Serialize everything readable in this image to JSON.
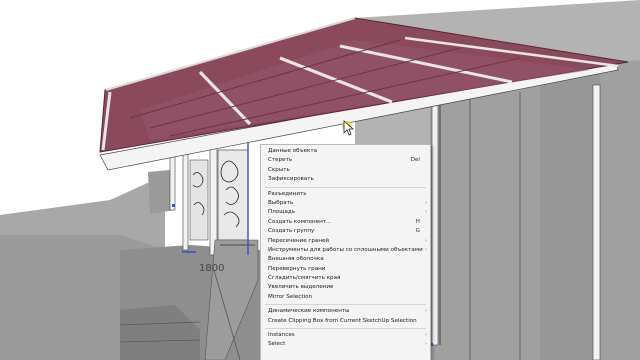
{
  "viewport": {
    "dimension_label": "1800",
    "colors": {
      "roof": "#8a4a5c",
      "roof_edge": "#6a2f3f",
      "wall": "#a3a3a3",
      "ground": "#9c9c9c",
      "background": "#ffffff"
    }
  },
  "context_menu": {
    "items": [
      {
        "label": "Данные объекта",
        "shortcut": "",
        "submenu": false
      },
      {
        "label": "Стереть",
        "shortcut": "Del",
        "submenu": false
      },
      {
        "label": "Скрыть",
        "shortcut": "",
        "submenu": false
      },
      {
        "label": "Зафиксировать",
        "shortcut": "",
        "submenu": false
      },
      {
        "separator": true
      },
      {
        "label": "Разъединить",
        "shortcut": "",
        "submenu": false
      },
      {
        "label": "Выбрать",
        "shortcut": "",
        "submenu": true
      },
      {
        "label": "Площадь",
        "shortcut": "",
        "submenu": true
      },
      {
        "label": "Создать компонент...",
        "shortcut": "H",
        "submenu": false
      },
      {
        "label": "Создать группу",
        "shortcut": "G",
        "submenu": false
      },
      {
        "label": "Пересечение граней",
        "shortcut": "",
        "submenu": true
      },
      {
        "label": "Инструменты для работы со сплошными объектами",
        "shortcut": "",
        "submenu": true
      },
      {
        "label": "Внешняя оболочка",
        "shortcut": "",
        "submenu": false
      },
      {
        "label": "Перевернуть грани",
        "shortcut": "",
        "submenu": false
      },
      {
        "label": "Сгладить/смягчить края",
        "shortcut": "",
        "submenu": false
      },
      {
        "label": "Увеличить выделение",
        "shortcut": "",
        "submenu": false
      },
      {
        "label": "Mirror Selection",
        "shortcut": "",
        "submenu": false
      },
      {
        "separator": true
      },
      {
        "label": "Динамические компоненты",
        "shortcut": "",
        "submenu": true
      },
      {
        "label": "Create Clipping Box from Current SketchUp Selection",
        "shortcut": "",
        "submenu": false
      },
      {
        "separator": true
      },
      {
        "label": "Instances",
        "shortcut": "",
        "submenu": true
      },
      {
        "label": "Select",
        "shortcut": "",
        "submenu": true
      }
    ]
  }
}
